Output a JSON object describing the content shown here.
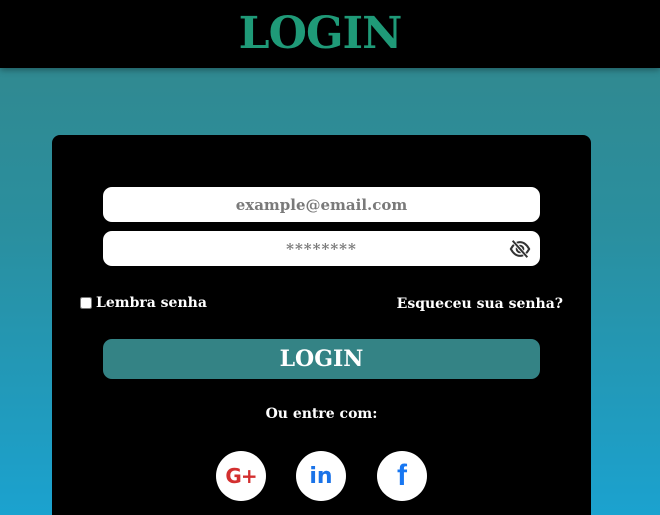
{
  "header": {
    "title": "LOGIN"
  },
  "form": {
    "email": {
      "value": "",
      "placeholder": "example@email.com"
    },
    "password": {
      "value": "",
      "placeholder": "********"
    },
    "remember_label": "Lembra senha",
    "remember_checked": false,
    "forgot_label": "Esqueceu sua senha?",
    "submit_label": "LOGIN",
    "alt_login_label": "Ou entre com:"
  },
  "social": [
    {
      "name": "google-plus",
      "glyph": "G+",
      "color": "#d32f2f"
    },
    {
      "name": "linkedin",
      "glyph": "in",
      "color": "#1a73e8"
    },
    {
      "name": "facebook",
      "glyph": "f",
      "color": "#1877f2"
    }
  ],
  "colors": {
    "header_bg": "#000000",
    "title_accent": "#1f9a78",
    "button_bg": "#348385",
    "gradient_top": "#33878b",
    "gradient_bottom": "#1ba2cf"
  }
}
